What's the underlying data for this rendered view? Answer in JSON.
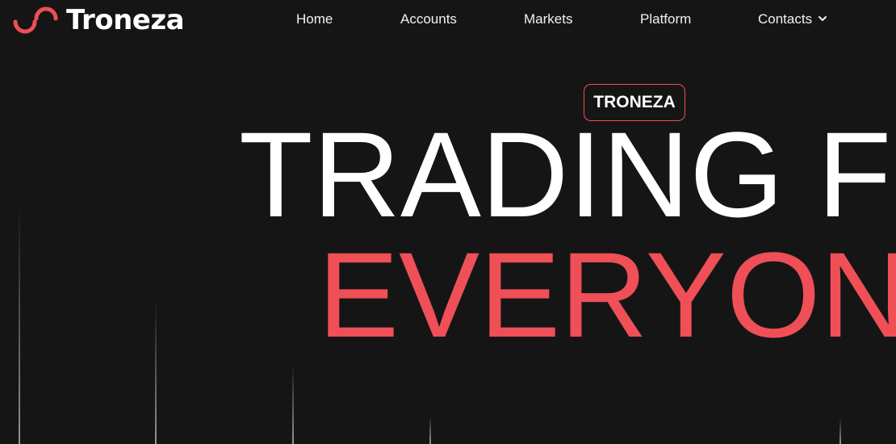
{
  "header": {
    "brand": "Troneza",
    "nav": [
      {
        "label": "Home"
      },
      {
        "label": "Accounts"
      },
      {
        "label": "Markets"
      },
      {
        "label": "Platform"
      },
      {
        "label": "Contacts",
        "has_dropdown": true
      }
    ]
  },
  "hero": {
    "badge": "TRONEZA",
    "headline_line1": "TRADING FOR",
    "headline_line2": "EVERYONE"
  },
  "colors": {
    "background": "#161516",
    "accent": "#ef4f56",
    "text": "#ffffff"
  },
  "icons": {
    "logo": "swirl-logo-icon",
    "dropdown": "chevron-down-icon"
  }
}
